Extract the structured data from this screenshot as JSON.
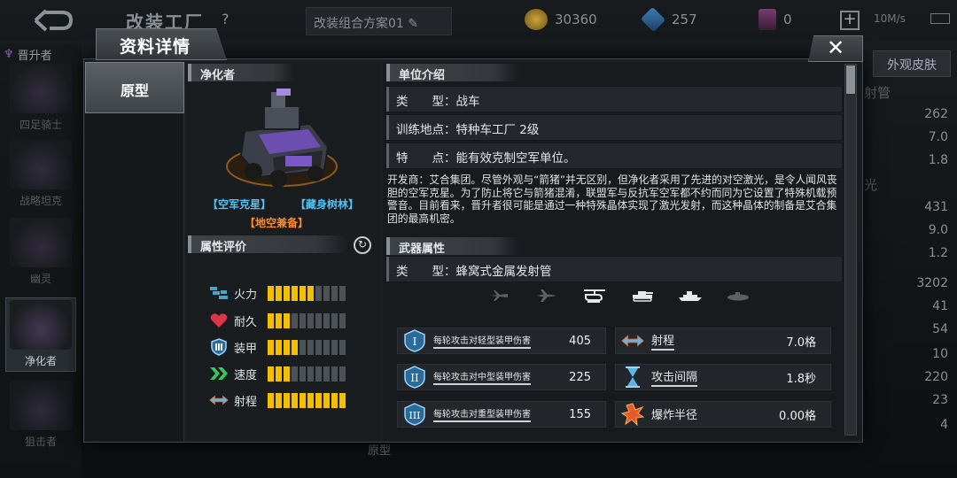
{
  "background": {
    "title": "改装工厂",
    "help": "?",
    "combo": "改装组合方案01",
    "gold": "30360",
    "diamond": "257",
    "ticket": "0",
    "network": "10M/s",
    "upgrade_label": "晋升者",
    "skin_tab": "外观皮肤",
    "bottom_label": "原型",
    "units": [
      "四足骑士",
      "战略坦克",
      "幽灵",
      "净化者",
      "狙击者"
    ],
    "sections": [
      "射管",
      "光"
    ],
    "values": [
      "262",
      "7.0",
      "1.8",
      "431",
      "9.0",
      "1.2",
      "3202",
      "41",
      "54",
      "10",
      "220",
      "23",
      "4"
    ]
  },
  "modal": {
    "title": "资料详情",
    "close": "✕",
    "tab": "原型",
    "unit_name": "净化者",
    "tags": [
      "【空军克星】",
      "【藏身树林】",
      "【地空兼备】"
    ],
    "attr_header": "属性评价",
    "stats": [
      {
        "label": "火力",
        "level": 6,
        "max": 10,
        "icon": "firepower-icon",
        "color": "#4aa3c8"
      },
      {
        "label": "耐久",
        "level": 3,
        "max": 10,
        "icon": "heart-icon",
        "color": "#e0344a"
      },
      {
        "label": "装甲",
        "level": 4,
        "max": 10,
        "icon": "armor-icon",
        "color": "#4aa3c8"
      },
      {
        "label": "速度",
        "level": 3,
        "max": 10,
        "icon": "speed-icon",
        "color": "#3cc35a"
      },
      {
        "label": "射程",
        "level": 10,
        "max": 10,
        "icon": "range-icon",
        "color": "#4aa3c8"
      }
    ],
    "intro_header": "单位介绍",
    "intro_rows": [
      "类　　型：战车",
      "训练地点：特种车工厂 2级",
      "特　　点：能有效克制空军单位。"
    ],
    "description": "开发商：艾合集团。尽管外观与“箭猪”并无区别，但净化者采用了先进的对空激光，是令人闻风丧胆的空军克星。为了防止将它与箭猪混淆，联盟军与反抗军空军都不约而同为它设置了特殊机载预警音。目前看来，晋升者很可能是通过一种特殊晶体实现了激光发射，而这种晶体的制备是艾合集团的最高机密。",
    "weapon_header": "武器属性",
    "weapon_type": "类　　型：蜂窝式金属发射管",
    "targets": [
      {
        "icon": "fighter-jet-icon",
        "active": false
      },
      {
        "icon": "bomber-icon",
        "active": false
      },
      {
        "icon": "helicopter-icon",
        "active": true
      },
      {
        "icon": "tank-icon",
        "active": true
      },
      {
        "icon": "ship-icon",
        "active": true
      },
      {
        "icon": "submarine-icon",
        "active": false
      }
    ],
    "weapon_stats": {
      "light_label": "每轮攻击对轻型装甲伤害",
      "light_value": "405",
      "medium_label": "每轮攻击对中型装甲伤害",
      "medium_value": "225",
      "heavy_label": "每轮攻击对重型装甲伤害",
      "heavy_value": "155",
      "range_label": "射程",
      "range_value": "7.0格",
      "interval_label": "攻击间隔",
      "interval_value": "1.8秒",
      "blast_label": "爆炸半径",
      "blast_value": "0.00格"
    }
  },
  "colors": {
    "accent_gold": "#f2c000",
    "tag_blue": "#4fc3f7",
    "tag_orange": "#ff8a2a",
    "bar_off": "#4d5257"
  }
}
